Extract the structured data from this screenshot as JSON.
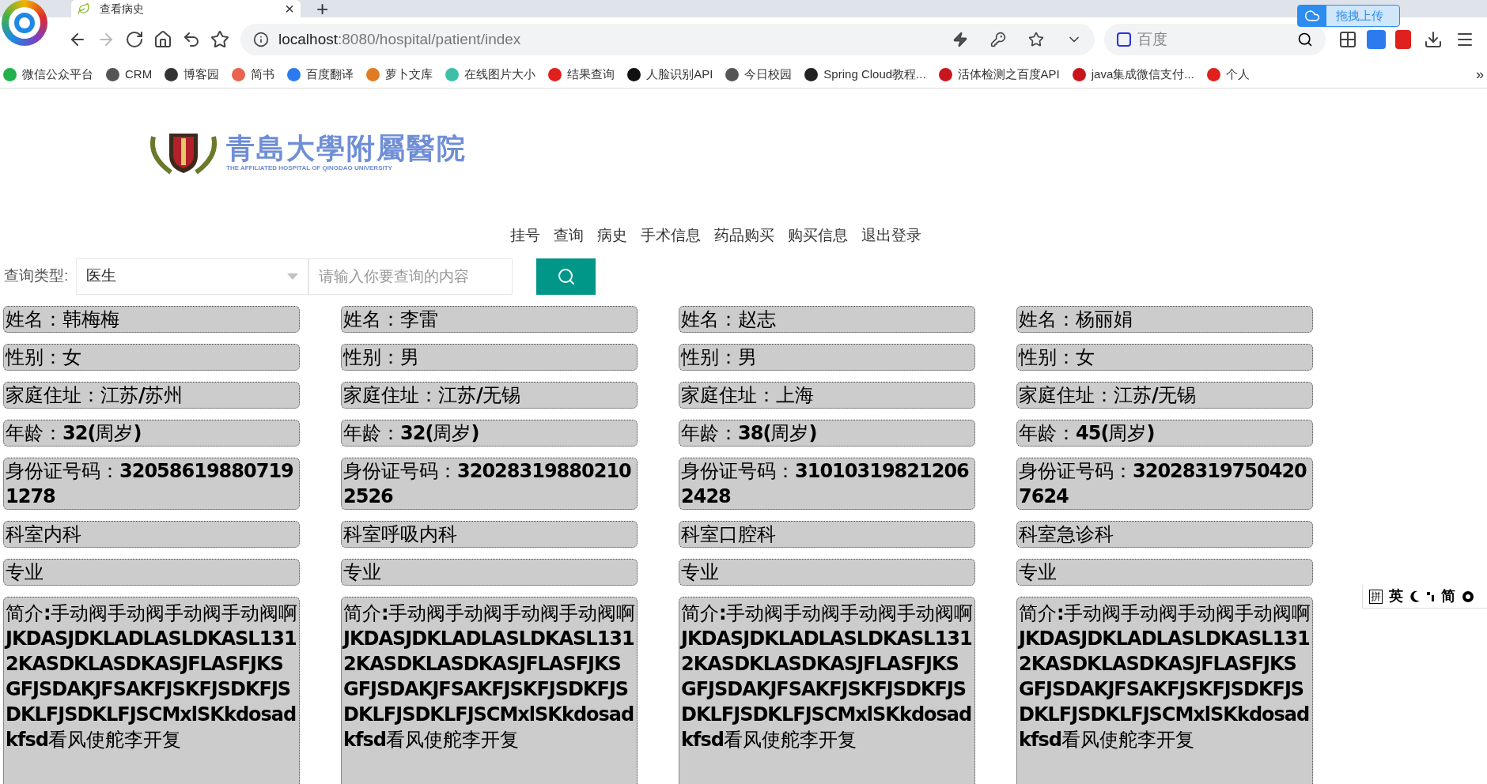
{
  "browser": {
    "tab": {
      "title": "查看病史",
      "close": "×"
    },
    "new_tab": "+",
    "url_host": "localhost",
    "url_path": ":8080/hospital/patient/index",
    "search_placeholder": "百度",
    "upload": "拖拽上传",
    "bookmarks": [
      {
        "label": "微信公众平台",
        "color": "#22b14c"
      },
      {
        "label": "CRM",
        "color": "#555555"
      },
      {
        "label": "博客园",
        "color": "#333333"
      },
      {
        "label": "简书",
        "color": "#e9634e"
      },
      {
        "label": "百度翻译",
        "color": "#2b7bee"
      },
      {
        "label": "萝卜文库",
        "color": "#e07b22"
      },
      {
        "label": "在线图片大小",
        "color": "#3dbfa8"
      },
      {
        "label": "结果查询",
        "color": "#e0201d"
      },
      {
        "label": "人脸识别API",
        "color": "#111111"
      },
      {
        "label": "今日校园",
        "color": "#555555"
      },
      {
        "label": "Spring Cloud教程...",
        "color": "#222222"
      },
      {
        "label": "活体检测之百度API",
        "color": "#c8161d"
      },
      {
        "label": "java集成微信支付...",
        "color": "#c8161d"
      },
      {
        "label": "个人",
        "color": "#e0201d"
      }
    ],
    "more": "»"
  },
  "logo": {
    "title": "青島大學附屬醫院",
    "subtitle": "THE AFFILIATED HOSPITAL OF QINGDAO UNIVERSITY"
  },
  "nav": [
    "挂号",
    "查询",
    "病史",
    "手术信息",
    "药品购买",
    "购买信息",
    "退出登录"
  ],
  "search": {
    "label": "查询类型:",
    "type": "医生",
    "placeholder": "请输入你要查询的内容"
  },
  "doctors": [
    {
      "name": "姓名：韩梅梅",
      "sex": "性别：女",
      "address": "家庭住址：江苏**/**苏州",
      "age": "年龄：**32(**周岁**)**",
      "id": "身份证号码：**320586198807191278**",
      "department": "科室内科",
      "major": "专业",
      "intro": "简介**:**手动阀手动阀手动阀手动阀啊**JKDASJDKLADLASLDKASL1312KASDKLASDKASJFLASFJKSGFJSDAKJFSAKFJSKFJSDKFJSDKLFJSDKLFJSCMxlSKkdosadkfsd**看风使舵李开复"
    },
    {
      "name": "姓名：李雷",
      "sex": "性别：男",
      "address": "家庭住址：江苏**/**无锡",
      "age": "年龄：**32(**周岁**)**",
      "id": "身份证号码：**320283198802102526**",
      "department": "科室呼吸内科",
      "major": "专业",
      "intro": "简介**:**手动阀手动阀手动阀手动阀啊**JKDASJDKLADLASLDKASL1312KASDKLASDKASJFLASFJKSGFJSDAKJFSAKFJSKFJSDKFJSDKLFJSDKLFJSCMxlSKkdosadkfsd**看风使舵李开复"
    },
    {
      "name": "姓名：赵志",
      "sex": "性别：男",
      "address": "家庭住址：上海",
      "age": "年龄：**38(**周岁**)**",
      "id": "身份证号码：**310103198212062428**",
      "department": "科室口腔科",
      "major": "专业",
      "intro": "简介**:**手动阀手动阀手动阀手动阀啊**JKDASJDKLADLASLDKASL1312KASDKLASDKASJFLASFJKSGFJSDAKJFSAKFJSKFJSDKFJSDKLFJSDKLFJSCMxlSKkdosadkfsd**看风使舵李开复"
    },
    {
      "name": "姓名：杨丽娟",
      "sex": "性别：女",
      "address": "家庭住址：江苏**/**无锡",
      "age": "年龄：**45(**周岁**)**",
      "id": "身份证号码：**320283197504207624**",
      "department": "科室急诊科",
      "major": "专业",
      "intro": "简介**:**手动阀手动阀手动阀手动阀啊**JKDASJDKLADLASLDKASL1312KASDKLASDKASJFLASFJKSGFJSDAKJFSAKFJSKFJSDKFJSDKLFJSDKLFJSCMxlSKkdosadkfsd**看风使舵李开复"
    }
  ],
  "ime": [
    "拼",
    "英",
    "简"
  ]
}
